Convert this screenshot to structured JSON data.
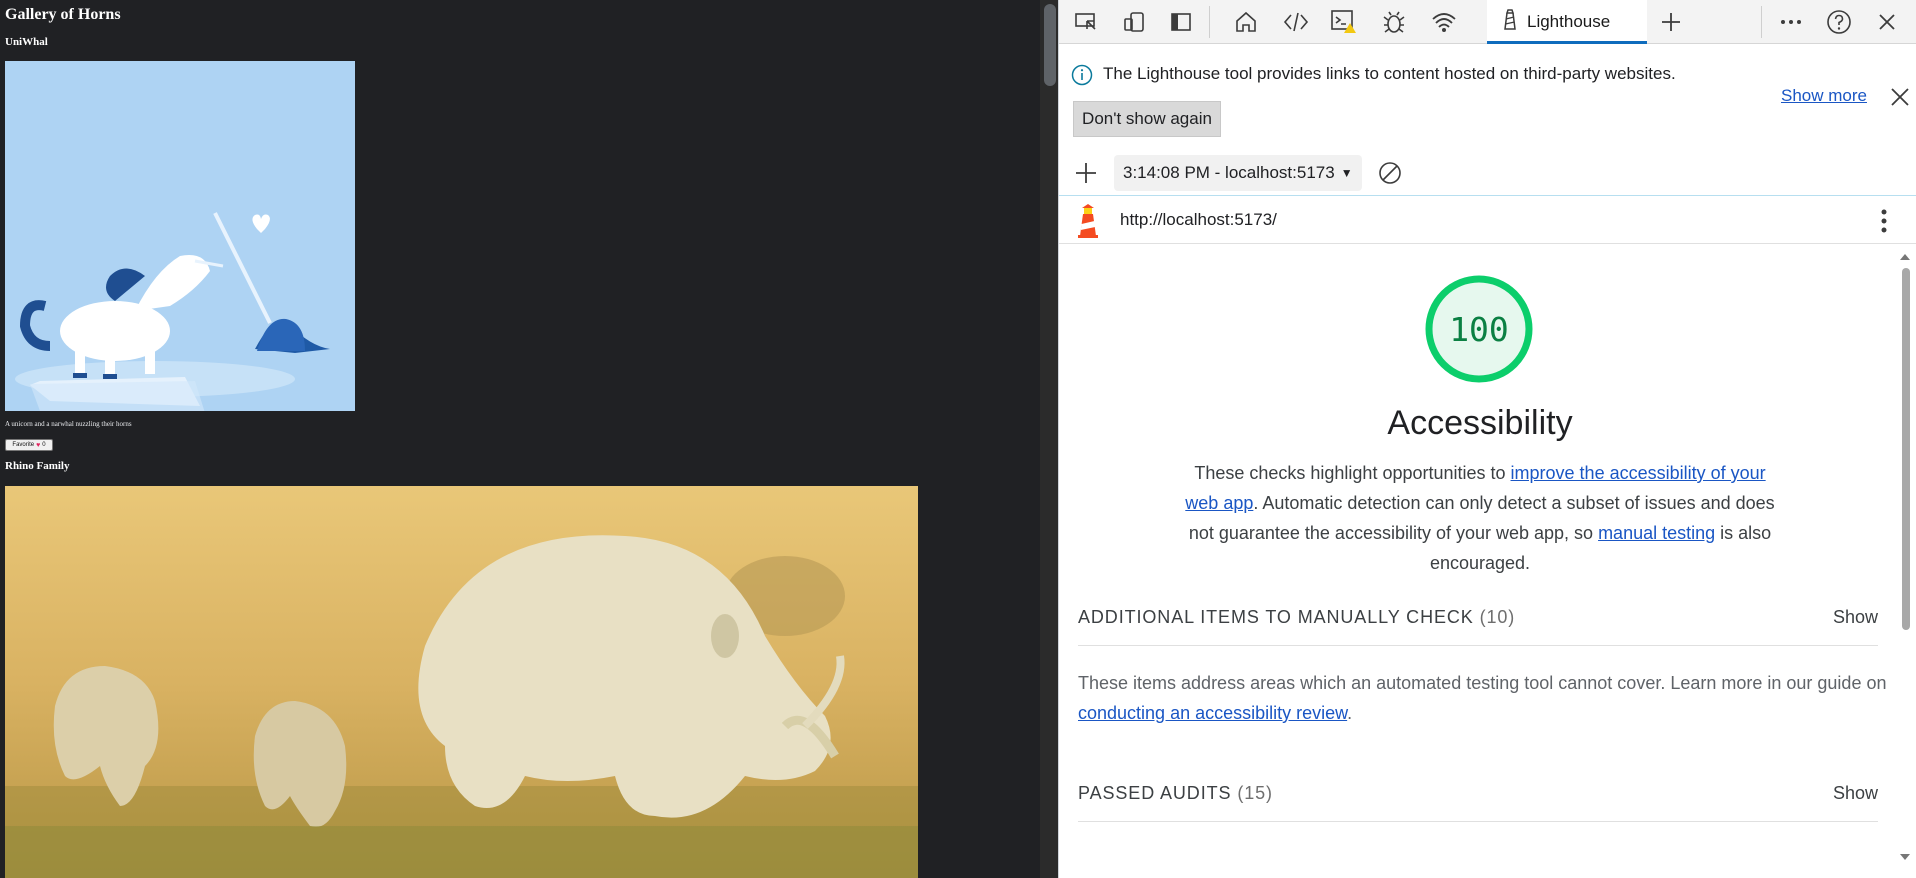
{
  "page": {
    "title": "Gallery of Horns",
    "uni_title": "UniWhal",
    "uni_caption": "A unicorn and a narwhal nuzzling their horns",
    "fav_label": "Favorite",
    "fav_count": "0",
    "rhino_title": "Rhino Family"
  },
  "devtools": {
    "tabs": [
      {
        "icon": "inspect-icon"
      },
      {
        "icon": "device-emulation-icon"
      },
      {
        "icon": "dock-sidebar-icon"
      },
      {
        "icon": "home-icon"
      },
      {
        "icon": "elements-icon"
      },
      {
        "icon": "console-warning-icon"
      },
      {
        "icon": "bug-icon"
      },
      {
        "icon": "network-wifi-icon"
      }
    ],
    "active_tab": "Lighthouse",
    "info": {
      "text": "The Lighthouse tool provides links to content hosted on third-party websites.",
      "dont_show": "Don't show again",
      "show_more": "Show more"
    },
    "report_select": "3:14:08 PM - localhost:5173",
    "url": "http://localhost:5173/",
    "score": "100",
    "score_value": 100,
    "category_title": "Accessibility",
    "desc": {
      "p1": "These checks highlight opportunities to ",
      "link1": "improve the accessibility of your web app",
      "p2": ". Automatic detection can only detect a subset of issues and does not guarantee the accessibility of your web app, so ",
      "link2": "manual testing",
      "p3": " is also encouraged."
    },
    "manual": {
      "title": "ADDITIONAL ITEMS TO MANUALLY CHECK",
      "count": "(10)",
      "show": "Show",
      "desc": "These items address areas which an automated testing tool cannot cover. Learn more in our guide on ",
      "link": "conducting an accessibility review",
      "end": "."
    },
    "passed": {
      "title": "PASSED AUDITS",
      "count": "(15)",
      "show": "Show"
    },
    "colors": {
      "pass": "#0cce6b",
      "pass_bg": "#e6f8ee",
      "link": "#1a56c4",
      "accent": "#0f6cbd"
    }
  }
}
